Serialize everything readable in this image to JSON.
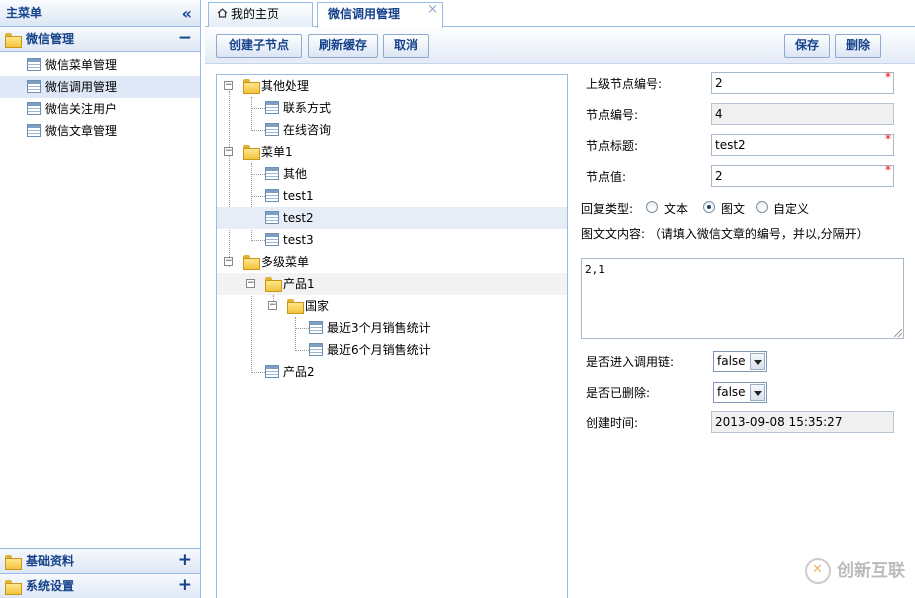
{
  "sidebar": {
    "title": "主菜单",
    "collapse_glyph": "«",
    "group_weixin": {
      "label": "微信管理",
      "tool": "−"
    },
    "items": [
      {
        "label": "微信菜单管理"
      },
      {
        "label": "微信调用管理"
      },
      {
        "label": "微信关注用户"
      },
      {
        "label": "微信文章管理"
      }
    ],
    "group_basic": {
      "label": "基础资料",
      "tool": "+"
    },
    "group_system": {
      "label": "系统设置",
      "tool": "+"
    }
  },
  "tabs": {
    "home": "我的主页",
    "active": "微信调用管理",
    "close_glyph": "×"
  },
  "toolbar": {
    "create_child": "创建子节点",
    "refresh_cache": "刷新缓存",
    "cancel": "取消",
    "save": "保存",
    "delete": "删除"
  },
  "tree": {
    "n0": "其他处理",
    "n1": "联系方式",
    "n2": "在线咨询",
    "n3": "菜单1",
    "n4": "其他",
    "n5": "test1",
    "n6": "test2",
    "n7": "test3",
    "n8": "多级菜单",
    "n9": "产品1",
    "n10": "国家",
    "n11": "最近3个月销售统计",
    "n12": "最近6个月销售统计",
    "n13": "产品2"
  },
  "form": {
    "parent_id_label": "上级节点编号:",
    "parent_id_value": "2",
    "node_id_label": "节点编号:",
    "node_id_value": "4",
    "title_label": "节点标题:",
    "title_value": "test2",
    "value_label": "节点值:",
    "value_value": "2",
    "reply_type_label": "回复类型:",
    "reply_text": "文本",
    "reply_news": "图文",
    "reply_custom": "自定义",
    "news_content_label": "图文文内容: （请填入微信文章的编号，并以,分隔开）",
    "news_content_value": "2,1",
    "call_chain_label": "是否进入调用链:",
    "call_chain_value": "false",
    "deleted_label": "是否已删除:",
    "deleted_value": "false",
    "created_label": "创建时间:",
    "created_value": "2013-09-08 15:35:27",
    "required_mark": "*"
  },
  "watermark": {
    "text": "创新互联"
  }
}
